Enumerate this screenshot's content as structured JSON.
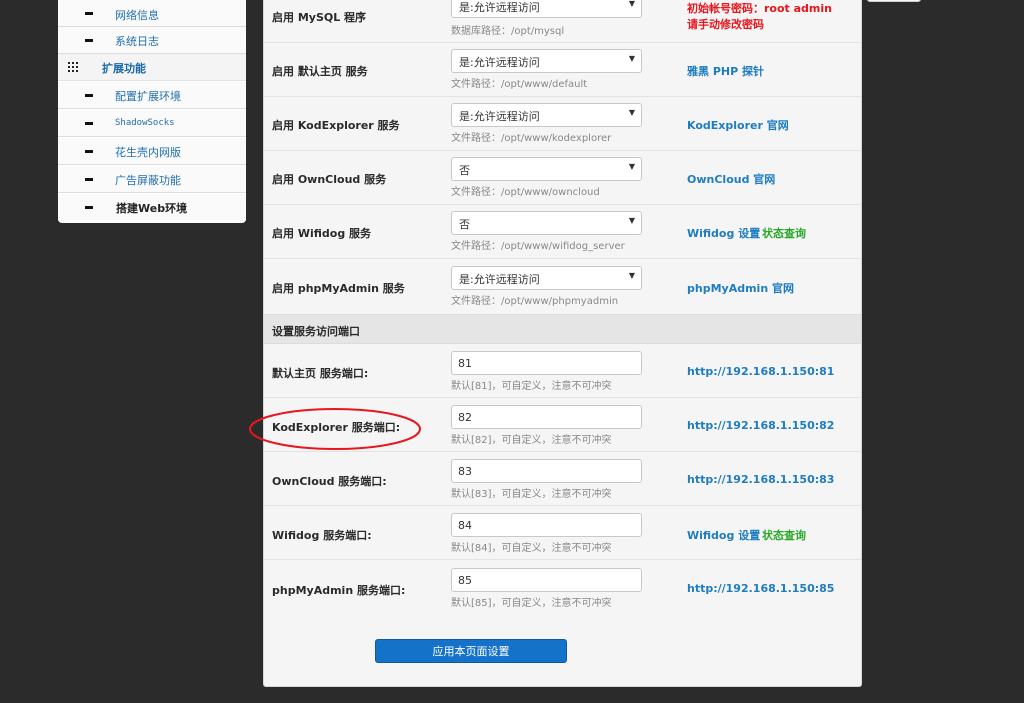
{
  "sidebar": {
    "items": [
      {
        "label": "网络信息",
        "kind": "sub"
      },
      {
        "label": "系统日志",
        "kind": "sub"
      },
      {
        "label": "扩展功能",
        "kind": "group"
      },
      {
        "label": "配置扩展环境",
        "kind": "sub"
      },
      {
        "label": "ShadowSocks",
        "kind": "sub-mono"
      },
      {
        "label": "花生壳内网版",
        "kind": "sub"
      },
      {
        "label": "广告屏蔽功能",
        "kind": "sub"
      },
      {
        "label": "搭建Web环境",
        "kind": "sub-strong"
      }
    ]
  },
  "services": [
    {
      "label": "启用 MySQL 程序",
      "value": "是:允许远程访问",
      "hint": "数据库路径：/opt/mysql",
      "note_lines": [
        "初始帐号密码：root admin",
        "请手动修改密码"
      ]
    },
    {
      "label": "启用 默认主页 服务",
      "value": "是:允许远程访问",
      "hint": "文件路径：/opt/www/default",
      "link": "雅黑 PHP 探针"
    },
    {
      "label": "启用 KodExplorer 服务",
      "value": "是:允许远程访问",
      "hint": "文件路径：/opt/www/kodexplorer",
      "link": "KodExplorer 官网"
    },
    {
      "label": "启用 OwnCloud 服务",
      "value": "否",
      "hint": "文件路径：/opt/www/owncloud",
      "link": "OwnCloud 官网"
    },
    {
      "label": "启用 Wifidog 服务",
      "value": "否",
      "hint": "文件路径：/opt/www/wifidog_server",
      "link": "Wifidog 设置",
      "link2": "状态查询"
    },
    {
      "label": "启用 phpMyAdmin 服务",
      "value": "是:允许远程访问",
      "hint": "文件路径：/opt/www/phpmyadmin",
      "link": "phpMyAdmin 官网"
    }
  ],
  "ports_section": {
    "title": "设置服务访问端口"
  },
  "ports": [
    {
      "label": "默认主页 服务端口:",
      "value": "81",
      "hint": "默认[81]，可自定义，注意不可冲突",
      "link": "http://192.168.1.150:81"
    },
    {
      "label": "KodExplorer 服务端口:",
      "value": "82",
      "hint": "默认[82]，可自定义，注意不可冲突",
      "link": "http://192.168.1.150:82"
    },
    {
      "label": "OwnCloud 服务端口:",
      "value": "83",
      "hint": "默认[83]，可自定义，注意不可冲突",
      "link": "http://192.168.1.150:83"
    },
    {
      "label": "Wifidog 服务端口:",
      "value": "84",
      "hint": "默认[84]，可自定义，注意不可冲突",
      "link": "Wifidog 设置",
      "link2": "状态查询"
    },
    {
      "label": "phpMyAdmin 服务端口:",
      "value": "85",
      "hint": "默认[85]，可自定义，注意不可冲突",
      "link": "http://192.168.1.150:85"
    }
  ],
  "apply_button": {
    "label": "应用本页面设置"
  },
  "colors": {
    "accent_blue": "#1e7cc0",
    "warning_red": "#e8161c",
    "link_green": "#2aa82a",
    "annotation_red": "#e8161c"
  }
}
